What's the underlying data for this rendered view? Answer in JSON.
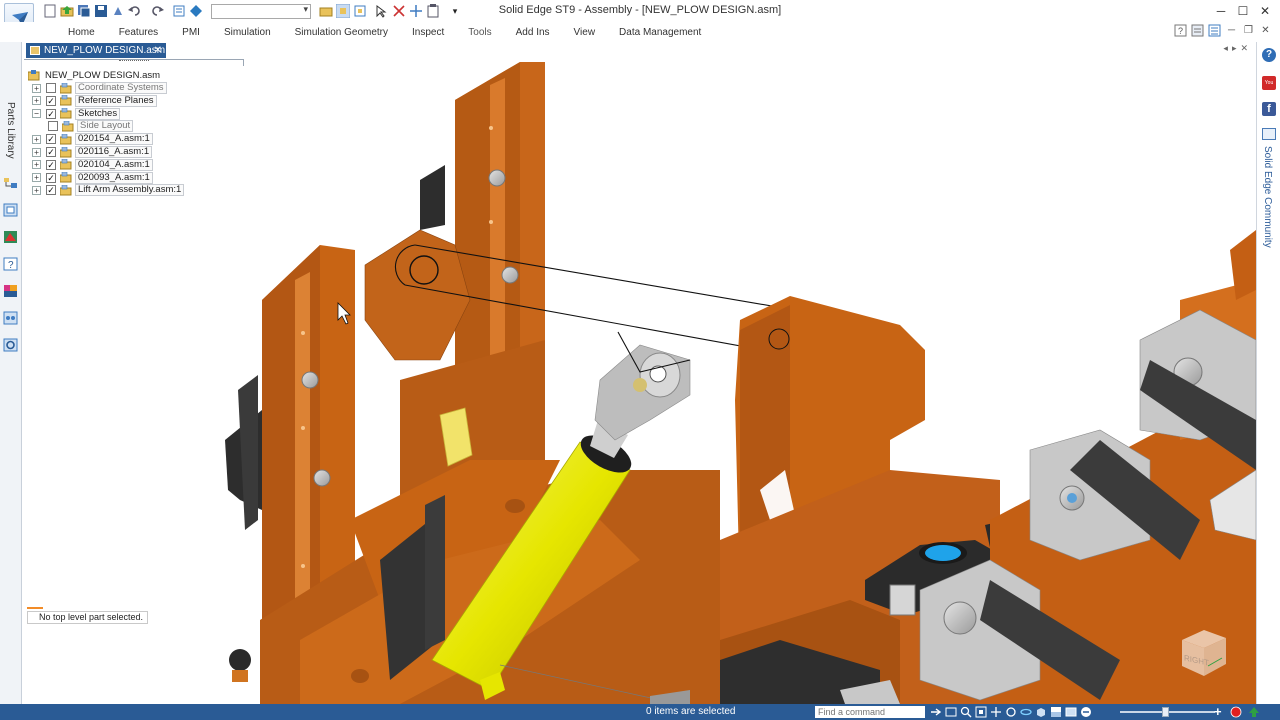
{
  "window": {
    "title": "Solid Edge ST9 - Assembly - [NEW_PLOW DESIGN.asm]",
    "controls": {
      "minimize": "─",
      "maximize": "☐",
      "close": "✕"
    }
  },
  "qat": {
    "combo_value": "",
    "icons": [
      "new-icon",
      "open-icon",
      "save-all-icon",
      "save-icon",
      "print-icon",
      "undo-icon",
      "redo-icon",
      "properties-icon",
      "teamcenter-icon",
      "folder-icon",
      "select-icon",
      "zoom-area-icon",
      "zoom-icon",
      "cursor-icon",
      "clear-icon",
      "move-icon",
      "paste-icon"
    ]
  },
  "ribbon": {
    "tabs": [
      {
        "label": "Home",
        "active": false
      },
      {
        "label": "Features",
        "active": false
      },
      {
        "label": "PMI",
        "active": false
      },
      {
        "label": "Simulation",
        "active": false
      },
      {
        "label": "Simulation Geometry",
        "active": false
      },
      {
        "label": "Inspect",
        "active": false
      },
      {
        "label": "Tools",
        "active": true
      },
      {
        "label": "Add Ins",
        "active": false
      },
      {
        "label": "View",
        "active": false
      },
      {
        "label": "Data Management",
        "active": false
      }
    ],
    "right_controls": [
      "help-icon",
      "options-icon",
      "layout-icon",
      "minimize-icon",
      "restore-icon",
      "close-icon"
    ]
  },
  "left_bar": {
    "parts_library_label": "Parts Library",
    "icons": [
      "pathfinder-icon",
      "feature-library-icon",
      "layers-icon",
      "sensors-icon",
      "family-icon",
      "configurations-icon",
      "settings-icon"
    ]
  },
  "document": {
    "tab_label": "NEW_PLOW DESIGN.asm",
    "tab_close": "✕",
    "right_controls": "◂▸✕"
  },
  "pathfinder": {
    "root": "NEW_PLOW DESIGN.asm",
    "items": [
      {
        "label": "Coordinate Systems",
        "expander": "+",
        "checked": false,
        "gray": true,
        "boxed": true,
        "indent": 0
      },
      {
        "label": "Reference Planes",
        "expander": "+",
        "checked": true,
        "gray": false,
        "boxed": true,
        "indent": 0
      },
      {
        "label": "Sketches",
        "expander": "−",
        "checked": true,
        "gray": false,
        "boxed": true,
        "indent": 0
      },
      {
        "label": "Side Layout",
        "expander": "",
        "checked": false,
        "gray": true,
        "boxed": true,
        "indent": 1
      },
      {
        "label": "020154_A.asm:1",
        "expander": "+",
        "checked": true,
        "gray": false,
        "boxed": true,
        "indent": 0
      },
      {
        "label": "020116_A.asm:1",
        "expander": "+",
        "checked": true,
        "gray": false,
        "boxed": true,
        "indent": 0
      },
      {
        "label": "020104_A.asm:1",
        "expander": "+",
        "checked": true,
        "gray": false,
        "boxed": true,
        "indent": 0
      },
      {
        "label": "020093_A.asm:1",
        "expander": "+",
        "checked": true,
        "gray": false,
        "boxed": true,
        "indent": 0
      },
      {
        "label": "Lift Arm Assembly.asm:1",
        "expander": "+",
        "checked": true,
        "gray": false,
        "boxed": true,
        "indent": 0
      }
    ],
    "status_message": "No top level part selected."
  },
  "viewport": {
    "view_cube_label": "RIGHT"
  },
  "right_bar": {
    "help_label": "?",
    "youtube_label": "You Tube",
    "facebook_label": "f",
    "community_label": "Solid Edge Community"
  },
  "statusbar": {
    "selection_text": "0 items are selected",
    "find_command_placeholder": "Find a command",
    "tool_icons": [
      "arrow-icon",
      "zoom-window-icon",
      "zoom-icon",
      "fit-icon",
      "pan-icon",
      "rotate-icon",
      "spin-icon",
      "view-icon",
      "shade-icon",
      "display-icon",
      "zoom-out-icon"
    ],
    "zoom_in": "+",
    "record_icon_color": "#e02020",
    "upload_icon_color": "#2ea043"
  },
  "colors": {
    "accent_blue": "#2a5b95",
    "plow_orange": "#c86414",
    "cylinder_yellow": "#e6e600",
    "steel_gray": "#b9b9b9",
    "dark_rubber": "#3a3a3a"
  }
}
